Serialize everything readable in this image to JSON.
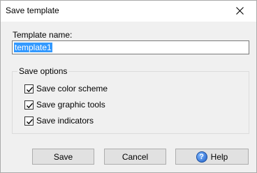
{
  "window": {
    "title": "Save template"
  },
  "template_name": {
    "label": "Template name:",
    "value": "template1"
  },
  "save_options": {
    "legend": "Save options",
    "items": [
      {
        "label": "Save color scheme",
        "checked": true
      },
      {
        "label": "Save graphic tools",
        "checked": true
      },
      {
        "label": "Save indicators",
        "checked": true
      }
    ]
  },
  "buttons": {
    "save": "Save",
    "cancel": "Cancel",
    "help": "Help"
  },
  "colors": {
    "selection": "#3399ff",
    "button_bg": "#e1e1e1",
    "dialog_bg": "#f0f0f0"
  }
}
